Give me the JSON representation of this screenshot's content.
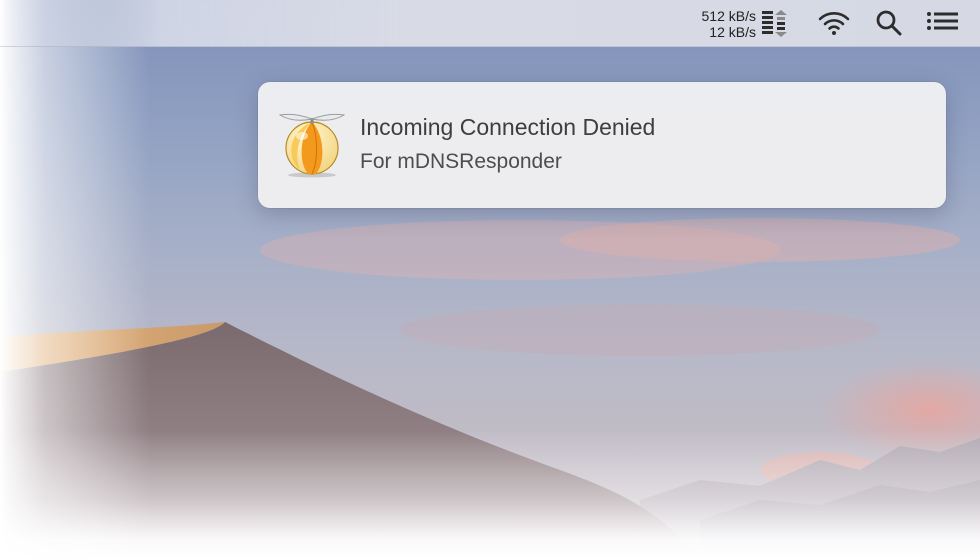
{
  "menubar": {
    "network": {
      "upload_rate": "512 kB/s",
      "download_rate": "12 kB/s"
    },
    "icons": [
      "network-activity-icon",
      "wifi-icon",
      "search-icon",
      "notification-center-icon"
    ]
  },
  "notification": {
    "app_icon": "little-snitch-icon",
    "title": "Incoming Connection Denied",
    "subtitle": "For mDNSResponder"
  }
}
